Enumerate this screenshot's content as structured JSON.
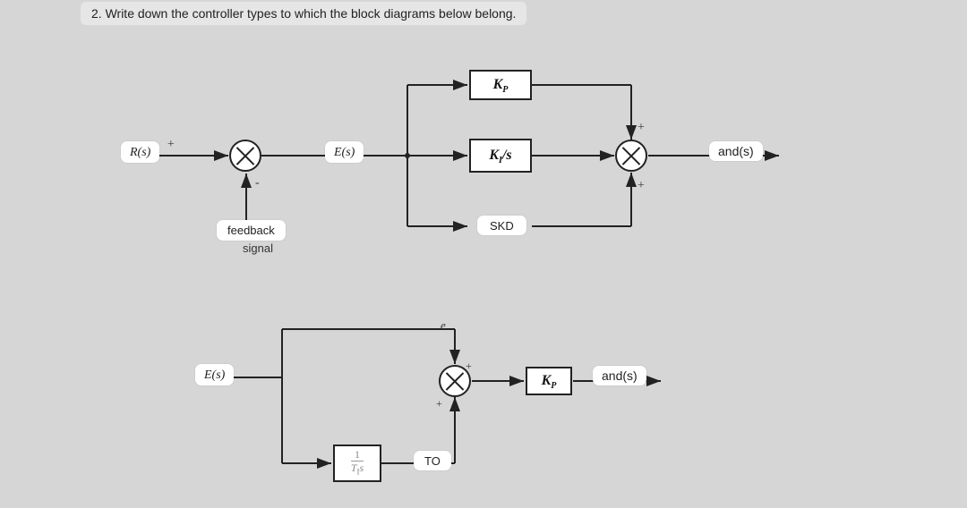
{
  "question": "2. Write down the controller types to which the block diagrams below belong.",
  "diagram1": {
    "input_label": "R(s)",
    "input_sign": "+",
    "error_label": "E(s)",
    "feedback_line1": "feedback",
    "feedback_line2": "signal",
    "feedback_sign": "-",
    "branch_kp": "Kₙ",
    "branch_kp_text": "K",
    "branch_kp_sub": "P",
    "branch_ki": "K",
    "branch_ki_sub": "I",
    "branch_ki_over": "/s",
    "branch_skd": "SKD",
    "sum2_sign_top": "+",
    "sum2_sign_bottom": "+",
    "output_label": "and(s)"
  },
  "diagram2": {
    "input_label": "E(s)",
    "branch_e_label": "e",
    "sum_sign_top": "+",
    "sum_sign_bottom": "+",
    "integrator_num": "1",
    "integrator_den_T": "T",
    "integrator_den_sub": "I",
    "integrator_den_s": "s",
    "to_label": "TO",
    "gain_kp_text": "K",
    "gain_kp_sub": "P",
    "output_label": "and(s)"
  }
}
